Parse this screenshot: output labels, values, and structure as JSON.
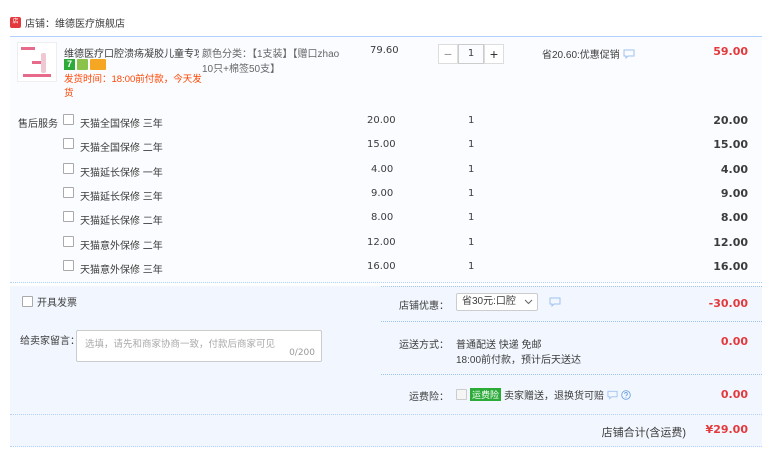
{
  "shop": {
    "label": "店铺：",
    "name": "维德医疗旗舰店"
  },
  "product": {
    "title": "维德医疗口腔溃疡凝胶儿童专攻...",
    "promo": "发货时间：18:00前付款，今天发货",
    "sku_line1": "颜色分类：【1支装】【赠口zhao",
    "sku_line2": "10只+棉签50支】",
    "unit_price": "79.60",
    "qty": "1",
    "discount": "省20.60:优惠促销",
    "subtotal": "59.00",
    "badge_7": "7",
    "qty_minus": "−",
    "qty_plus": "+"
  },
  "services": {
    "label": "售后服务",
    "rows": [
      {
        "name": "天猫全国保修 三年",
        "price": "20.00",
        "qty": "1",
        "total": "20.00"
      },
      {
        "name": "天猫全国保修 二年",
        "price": "15.00",
        "qty": "1",
        "total": "15.00"
      },
      {
        "name": "天猫延长保修 一年",
        "price": "4.00",
        "qty": "1",
        "total": "4.00"
      },
      {
        "name": "天猫延长保修 三年",
        "price": "9.00",
        "qty": "1",
        "total": "9.00"
      },
      {
        "name": "天猫延长保修 二年",
        "price": "8.00",
        "qty": "1",
        "total": "8.00"
      },
      {
        "name": "天猫意外保修 二年",
        "price": "12.00",
        "qty": "1",
        "total": "12.00"
      },
      {
        "name": "天猫意外保修 三年",
        "price": "16.00",
        "qty": "1",
        "total": "16.00"
      }
    ]
  },
  "invoice": {
    "label": "开具发票"
  },
  "message": {
    "label": "给卖家留言：",
    "placeholder": "选填，请先和商家协商一致，付款后商家可见",
    "counter": "0/200"
  },
  "coupon": {
    "label": "店铺优惠：",
    "selected": "省30元:口腔",
    "amount": "-30.00"
  },
  "shipping": {
    "label": "运送方式：",
    "line1": "普通配送 快递 免邮",
    "line2": "18:00前付款，预计后天送达",
    "amount": "0.00"
  },
  "insurance": {
    "label": "运费险：",
    "tag": "运费险",
    "text": "卖家赠送，退换货可赔",
    "amount": "0.00"
  },
  "total": {
    "label": "店铺合计(含运费)",
    "amount": "¥29.00"
  },
  "colors": {
    "accent": "#e4393c",
    "border": "#b2d1ff",
    "bottom_bg": "#f2f7ff"
  }
}
